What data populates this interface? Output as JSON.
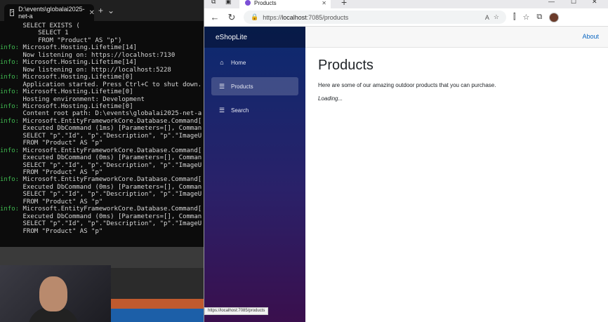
{
  "terminal": {
    "tab_title": "D:\\events\\globalai2025-net-a",
    "lines": [
      {
        "level": "",
        "text": "      SELECT EXISTS ("
      },
      {
        "level": "",
        "text": "          SELECT 1"
      },
      {
        "level": "",
        "text": "          FROM \"Product\" AS \"p\")"
      },
      {
        "level": "info:",
        "text": " Microsoft.Hosting.Lifetime[14]"
      },
      {
        "level": "",
        "text": "      Now listening on: https://localhost:7130"
      },
      {
        "level": "info:",
        "text": " Microsoft.Hosting.Lifetime[14]"
      },
      {
        "level": "",
        "text": "      Now listening on: http://localhost:5228"
      },
      {
        "level": "info:",
        "text": " Microsoft.Hosting.Lifetime[0]"
      },
      {
        "level": "",
        "text": "      Application started. Press Ctrl+C to shut down."
      },
      {
        "level": "info:",
        "text": " Microsoft.Hosting.Lifetime[0]"
      },
      {
        "level": "",
        "text": "      Hosting environment: Development"
      },
      {
        "level": "info:",
        "text": " Microsoft.Hosting.Lifetime[0]"
      },
      {
        "level": "",
        "text": "      Content root path: D:\\events\\globalai2025-net-a"
      },
      {
        "level": "info:",
        "text": " Microsoft.EntityFrameworkCore.Database.Command["
      },
      {
        "level": "",
        "text": "      Executed DbCommand (1ms) [Parameters=[], Comman"
      },
      {
        "level": "",
        "text": "      SELECT \"p\".\"Id\", \"p\".\"Description\", \"p\".\"ImageU"
      },
      {
        "level": "",
        "text": "      FROM \"Product\" AS \"p\""
      },
      {
        "level": "info:",
        "text": " Microsoft.EntityFrameworkCore.Database.Command["
      },
      {
        "level": "",
        "text": "      Executed DbCommand (0ms) [Parameters=[], Comman"
      },
      {
        "level": "",
        "text": "      SELECT \"p\".\"Id\", \"p\".\"Description\", \"p\".\"ImageU"
      },
      {
        "level": "",
        "text": "      FROM \"Product\" AS \"p\""
      },
      {
        "level": "info:",
        "text": " Microsoft.EntityFrameworkCore.Database.Command["
      },
      {
        "level": "",
        "text": "      Executed DbCommand (0ms) [Parameters=[], Comman"
      },
      {
        "level": "",
        "text": "      SELECT \"p\".\"Id\", \"p\".\"Description\", \"p\".\"ImageU"
      },
      {
        "level": "",
        "text": "      FROM \"Product\" AS \"p\""
      },
      {
        "level": "info:",
        "text": " Microsoft.EntityFrameworkCore.Database.Command["
      },
      {
        "level": "",
        "text": "      Executed DbCommand (0ms) [Parameters=[], Comman"
      },
      {
        "level": "",
        "text": "      SELECT \"p\".\"Id\", \"p\".\"Description\", \"p\".\"ImageU"
      },
      {
        "level": "",
        "text": "      FROM \"Product\" AS \"p\""
      }
    ]
  },
  "browser": {
    "tab_title": "Products",
    "address": {
      "scheme": "https://",
      "host": "localhost",
      "rest": ":7085/products"
    },
    "status_url": "https://localhost:7085/products"
  },
  "app": {
    "brand": "eShopLite",
    "about": "About",
    "nav": [
      {
        "label": "Home",
        "icon": "home-icon",
        "glyph": "⌂"
      },
      {
        "label": "Products",
        "icon": "list-icon",
        "glyph": "☰"
      },
      {
        "label": "Search",
        "icon": "list-icon",
        "glyph": "☰"
      }
    ],
    "title": "Products",
    "description": "Here are some of our amazing outdoor products that you can purchase.",
    "loading": "Loading..."
  }
}
